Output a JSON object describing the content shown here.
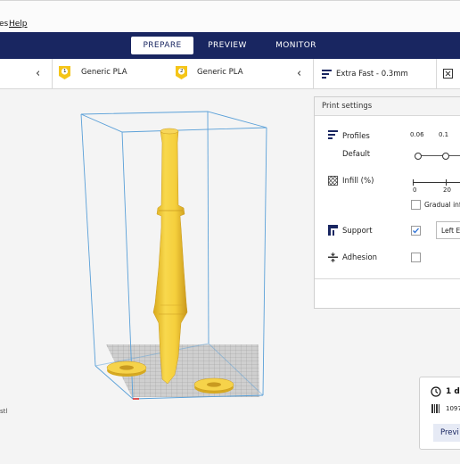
{
  "menu": {
    "items_fragment": "es",
    "help_label": "Help"
  },
  "stages": [
    {
      "label": "PREPARE",
      "active": true
    },
    {
      "label": "PREVIEW",
      "active": false
    },
    {
      "label": "MONITOR",
      "active": false
    }
  ],
  "extruders": [
    {
      "number": "1",
      "material": "Generic PLA",
      "badge_color": "#f5c518"
    },
    {
      "number": "2",
      "material": "Generic PLA",
      "badge_color": "#f5c518"
    }
  ],
  "print_profile": {
    "label": "Extra Fast - 0.3mm"
  },
  "print_settings": {
    "title": "Print settings",
    "profiles_label": "Profiles",
    "profile_value": "Default",
    "layer_ticks": [
      "0.06",
      "0.1"
    ],
    "infill_label": "Infill (%)",
    "infill_ticks": [
      "0",
      "20"
    ],
    "gradual_label": "Gradual infi",
    "support_label": "Support",
    "support_checked": true,
    "support_extruder": "Left Ex",
    "adhesion_label": "Adhesion",
    "adhesion_checked": false
  },
  "viewport": {
    "file_fragment": "stl",
    "model_color": "#f5d245"
  },
  "job": {
    "time_fragment": "1 da",
    "length_fragment": "1097",
    "preview_fragment": "Previ"
  }
}
